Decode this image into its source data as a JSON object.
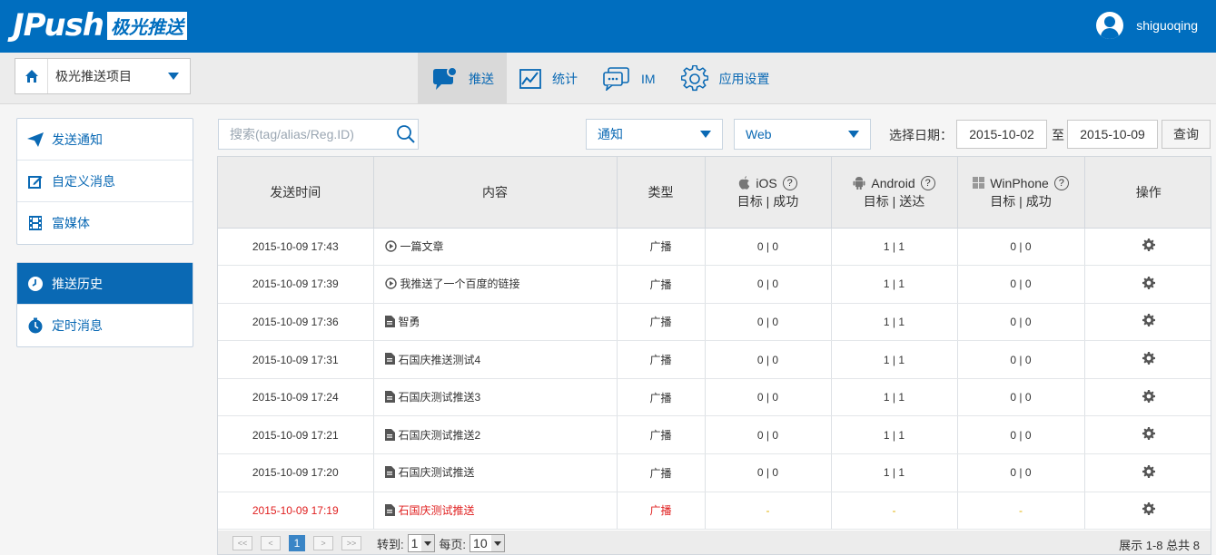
{
  "header": {
    "logo_text": "JPush",
    "logo_cn": "极光推送",
    "username": "shiguoqing"
  },
  "project": {
    "name": "极光推送项目"
  },
  "nav": [
    {
      "label": "推送",
      "icon": "chat-bubble-icon",
      "active": true
    },
    {
      "label": "统计",
      "icon": "line-chart-icon",
      "active": false
    },
    {
      "label": "IM",
      "icon": "messages-icon",
      "active": false
    },
    {
      "label": "应用设置",
      "icon": "gear-icon",
      "active": false
    }
  ],
  "sidebar": {
    "group1": [
      {
        "label": "发送通知",
        "icon": "paper-plane-icon"
      },
      {
        "label": "自定义消息",
        "icon": "edit-icon"
      },
      {
        "label": "富媒体",
        "icon": "film-icon"
      }
    ],
    "group2": [
      {
        "label": "推送历史",
        "icon": "clock-icon",
        "active": true
      },
      {
        "label": "定时消息",
        "icon": "timer-icon",
        "active": false
      }
    ]
  },
  "toolbar": {
    "search_placeholder": "搜索(tag/alias/Reg.ID)",
    "type_select": "通知",
    "platform_select": "Web",
    "date_label": "选择日期：",
    "date_from": "2015-10-02",
    "date_sep": "至",
    "date_to": "2015-10-09",
    "query_label": "查询"
  },
  "table": {
    "headers": {
      "time": "发送时间",
      "content": "内容",
      "type": "类型",
      "ios": "iOS",
      "ios_sub": "目标 | 成功",
      "android": "Android",
      "android_sub": "目标 | 送达",
      "winphone": "WinPhone",
      "winphone_sub": "目标 | 成功",
      "ops": "操作"
    },
    "rows": [
      {
        "time": "2015-10-09 17:43",
        "icon": "play-circle-icon",
        "content": "一篇文章",
        "type": "广播",
        "ios": "0 | 0",
        "android": "1 | 1",
        "wp": "0 | 0"
      },
      {
        "time": "2015-10-09 17:39",
        "icon": "play-circle-icon",
        "content": "我推送了一个百度的链接",
        "type": "广播",
        "ios": "0 | 0",
        "android": "1 | 1",
        "wp": "0 | 0"
      },
      {
        "time": "2015-10-09 17:36",
        "icon": "document-icon",
        "content": "智勇",
        "type": "广播",
        "ios": "0 | 0",
        "android": "1 | 1",
        "wp": "0 | 0"
      },
      {
        "time": "2015-10-09 17:31",
        "icon": "document-icon",
        "content": "石国庆推送测试4",
        "type": "广播",
        "ios": "0 | 0",
        "android": "1 | 1",
        "wp": "0 | 0"
      },
      {
        "time": "2015-10-09 17:24",
        "icon": "document-icon",
        "content": "石国庆测试推送3",
        "type": "广播",
        "ios": "0 | 0",
        "android": "1 | 1",
        "wp": "0 | 0"
      },
      {
        "time": "2015-10-09 17:21",
        "icon": "document-icon",
        "content": "石国庆测试推送2",
        "type": "广播",
        "ios": "0 | 0",
        "android": "1 | 1",
        "wp": "0 | 0"
      },
      {
        "time": "2015-10-09 17:20",
        "icon": "document-icon",
        "content": "石国庆测试推送",
        "type": "广播",
        "ios": "0 | 0",
        "android": "1 | 1",
        "wp": "0 | 0"
      },
      {
        "time": "2015-10-09 17:19",
        "icon": "document-icon",
        "content": "石国庆测试推送",
        "type": "广播",
        "ios": "-",
        "android": "-",
        "wp": "-",
        "highlight": true
      }
    ]
  },
  "pager": {
    "first": "<<",
    "prev": "<",
    "current": "1",
    "next": ">",
    "last": ">>",
    "goto_label": "转到:",
    "goto_value": "1",
    "per_page_label": "每页:",
    "per_page_value": "10",
    "info": "展示 1-8 总共 8"
  },
  "colors": {
    "brand": "#006ebf",
    "highlight_text": "#e02020",
    "dash": "#e2b000"
  }
}
